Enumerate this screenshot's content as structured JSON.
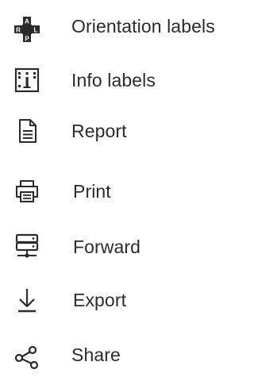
{
  "menu": {
    "items": [
      {
        "label": "Orientation labels",
        "icon": "orientation-labels-icon",
        "orientation_letters": [
          "A",
          "R",
          "L",
          "P"
        ]
      },
      {
        "label": "Info labels",
        "icon": "info-labels-icon"
      },
      {
        "label": "Report",
        "icon": "report-icon"
      },
      {
        "label": "Print",
        "icon": "printer-icon"
      },
      {
        "label": "Forward",
        "icon": "server-forward-icon"
      },
      {
        "label": "Export",
        "icon": "download-icon"
      },
      {
        "label": "Share",
        "icon": "share-icon"
      }
    ]
  },
  "colors": {
    "text": "#2b2b2b",
    "icon": "#2b2b2b",
    "background": "#ffffff"
  }
}
